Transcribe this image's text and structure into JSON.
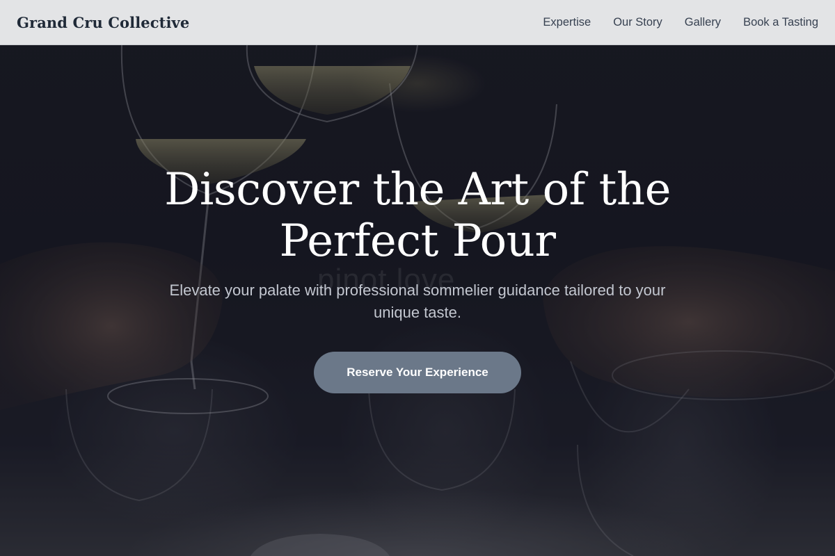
{
  "navbar": {
    "brand": "Grand Cru Collective",
    "links": [
      {
        "label": "Expertise"
      },
      {
        "label": "Our Story"
      },
      {
        "label": "Gallery"
      },
      {
        "label": "Book a Tasting"
      }
    ]
  },
  "hero": {
    "title_lines": [
      "Discover the Art of the",
      "Perfect Pour"
    ],
    "subtitle_lines": [
      "Elevate your palate with professional sommelier guidance tailored to your",
      "unique taste."
    ],
    "cta_label": "Reserve Your Experience",
    "background_watermark": "pinot love"
  },
  "colors": {
    "navbar_bg": "#e3e4e6",
    "brand_text": "#1f2937",
    "nav_text": "#374151",
    "hero_overlay": "#14141c",
    "title_text": "#ffffff",
    "subtitle_text": "#c3c7d0",
    "cta_bg": "#6b7889",
    "cta_text": "#ffffff"
  }
}
